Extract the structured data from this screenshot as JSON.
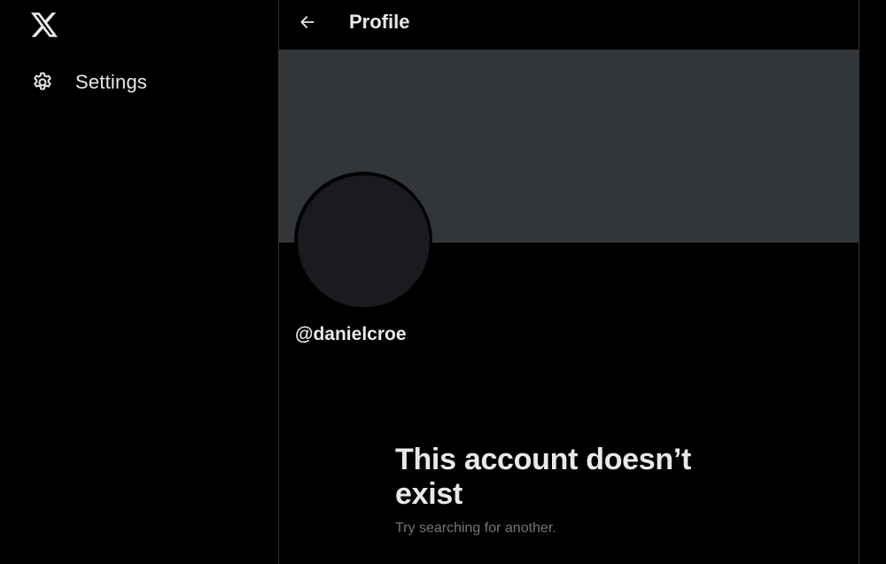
{
  "sidebar": {
    "logo_icon": "x-logo-icon",
    "items": [
      {
        "label": "Settings",
        "icon": "gear-icon"
      }
    ]
  },
  "header": {
    "back_icon": "arrow-left-icon",
    "title": "Profile"
  },
  "profile": {
    "handle": "@danielcroe"
  },
  "empty_state": {
    "title": "This account doesn’t exist",
    "subtitle": "Try searching for another."
  },
  "colors": {
    "background": "#000000",
    "banner": "#333639",
    "avatar": "#1a1b1f",
    "text_primary": "#e7e9ea",
    "text_secondary": "#71767b",
    "divider": "#2f3336"
  }
}
